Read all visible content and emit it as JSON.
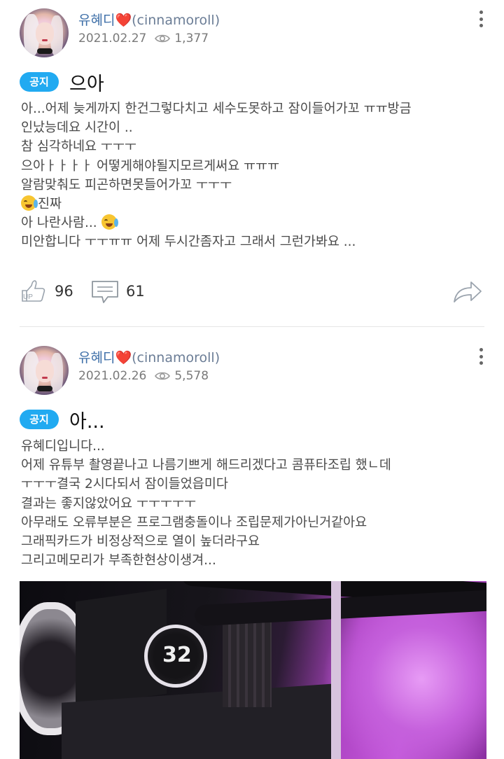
{
  "posts": [
    {
      "author": {
        "name": "유혜디",
        "heart": "❤️",
        "handle": "(cinnamoroll)"
      },
      "date": "2021.02.27",
      "views": "1,377",
      "badge": "공지",
      "title": "으아",
      "lines": [
        "아...어제 늦게까지 한건그렇다치고 세수도못하고 잠이들어가꼬 ㅠㅠ방금",
        "인났능데요 시간이 ..",
        "참 심각하네요 ㅜㅜㅜ",
        "으아ㅏㅏㅏㅏ 어떻게해야될지모르게써요 ㅠㅠㅠ",
        "알람맞춰도 피곤하면못들어가꼬 ㅜㅜㅜ",
        "진짜",
        "아 나란사람... ",
        "미안합니다 ㅜㅜㅠㅠ 어제 두시간좀자고 그래서 그런가봐요 ..."
      ],
      "likes": "96",
      "comments": "61"
    },
    {
      "author": {
        "name": "유혜디",
        "heart": "❤️",
        "handle": "(cinnamoroll)"
      },
      "date": "2021.02.26",
      "views": "5,578",
      "badge": "공지",
      "title": "아...",
      "lines": [
        "유혜디입니다...",
        "어제 유튜부 촬영끝나고 나름기쁘게 해드리겠다고 콤퓨타조립 했ㄴ데",
        "ㅜㅜㅜ결국 2시다되서 잠이들었읍미다",
        "결과는 좋지않았어요 ㅜㅜㅜㅜㅜ",
        "아무래도 오류부분은 프로그램충돌이나 조립문제가아닌거같아요",
        "그래픽카드가 비정상적으로 열이 높더라구요",
        "그리고메모리가 부족한현상이생겨..."
      ],
      "photo_text": "32"
    }
  ],
  "icons": {
    "like": "thumbs-up-icon",
    "like_label": "UP",
    "comment": "comment-icon",
    "share": "share-arrow-icon",
    "views": "eye-icon",
    "menu": "kebab-menu-icon"
  },
  "colors": {
    "badge": "#21aaf1",
    "author": "#3e6fa8",
    "heart": "#e0243a"
  }
}
